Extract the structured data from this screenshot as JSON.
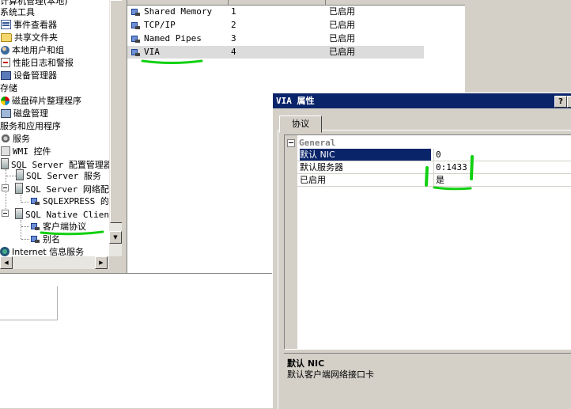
{
  "tree": {
    "items": [
      {
        "label": "系统工具"
      },
      {
        "label": "事件查看器"
      },
      {
        "label": "共享文件夹"
      },
      {
        "label": "本地用户和组"
      },
      {
        "label": "性能日志和警报"
      },
      {
        "label": "设备管理器"
      },
      {
        "label": "存储"
      },
      {
        "label": "磁盘碎片整理程序"
      },
      {
        "label": "磁盘管理"
      },
      {
        "label": "服务和应用程序"
      },
      {
        "label": "服务"
      },
      {
        "label": "WMI 控件"
      },
      {
        "label": "SQL Server 配置管理器"
      },
      {
        "label": "SQL Server 服务"
      },
      {
        "label": "SQL Server 网络配"
      },
      {
        "label": "SQLEXPRESS 的协"
      },
      {
        "label": "SQL Native Client"
      },
      {
        "label": "客户端协议"
      },
      {
        "label": "别名"
      },
      {
        "label": "Internet 信息服务"
      }
    ]
  },
  "list": {
    "rows": [
      {
        "name": "Shared Memory",
        "order": "1",
        "status": "已启用"
      },
      {
        "name": "TCP/IP",
        "order": "2",
        "status": "已启用"
      },
      {
        "name": "Named Pipes",
        "order": "3",
        "status": "已启用"
      },
      {
        "name": "VIA",
        "order": "4",
        "status": "已启用"
      }
    ]
  },
  "dialog": {
    "title": "VIA 属性",
    "help_glyph": "?",
    "close_glyph": "×",
    "tab_label": "协议",
    "category": "General",
    "properties": [
      {
        "key": "默认 NIC",
        "value": "0"
      },
      {
        "key": "默认服务器",
        "value": "0:1433"
      },
      {
        "key": "已启用",
        "value": "是"
      }
    ],
    "description_title": "默认 NIC",
    "description_text": "默认客户端网络接口卡"
  },
  "colors": {
    "titlebar": "#0a246a",
    "selection": "#0a246a",
    "annotation": "#12d012"
  }
}
